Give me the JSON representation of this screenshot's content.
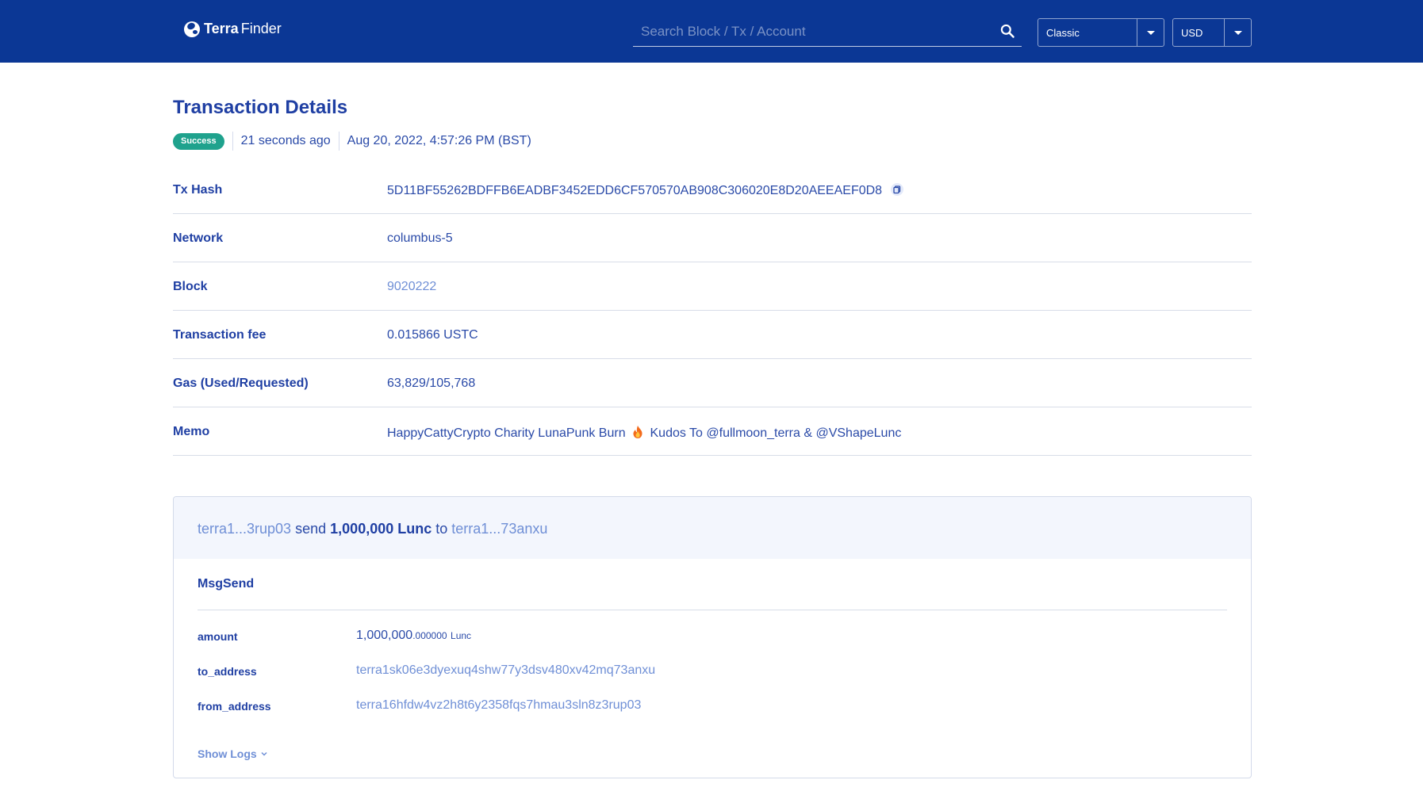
{
  "header": {
    "logo_strong": "Terra",
    "logo_light": "Finder",
    "search_placeholder": "Search Block / Tx / Account",
    "network_select": "Classic",
    "currency_select": "USD"
  },
  "page": {
    "title": "Transaction Details",
    "status": "Success",
    "time_ago": "21 seconds ago",
    "timestamp": "Aug 20, 2022, 4:57:26 PM (BST)"
  },
  "details": {
    "tx_hash": {
      "label": "Tx Hash",
      "value": "5D11BF55262BDFFB6EADBF3452EDD6CF570570AB908C306020E8D20AEEAEF0D8"
    },
    "network": {
      "label": "Network",
      "value": "columbus-5"
    },
    "block": {
      "label": "Block",
      "value": "9020222"
    },
    "fee": {
      "label": "Transaction fee",
      "value": "0.015866 USTC"
    },
    "gas": {
      "label": "Gas (Used/Requested)",
      "value": "63,829/105,768"
    },
    "memo": {
      "label": "Memo",
      "before_icon": "HappyCattyCrypto Charity LunaPunk Burn",
      "icon": "flame-icon",
      "after_icon": "Kudos To",
      "mention1": "@fullmoon_terra",
      "amp": "&",
      "mention2": "@VShapeLunc"
    }
  },
  "message": {
    "summary_from": "terra1...3rup03",
    "summary_action": "send",
    "summary_amount": "1,000,000 Lunc",
    "summary_to_word": "to",
    "summary_to": "terra1...73anxu",
    "type": "MsgSend",
    "fields": {
      "amount": {
        "label": "amount",
        "value_main": "1,000,000",
        "value_decimals": ".000000",
        "value_unit": "Lunc"
      },
      "to_address": {
        "label": "to_address",
        "value": "terra1sk06e3dyexuq4shw77y3dsv480xv42mq73anxu"
      },
      "from_address": {
        "label": "from_address",
        "value": "terra16hfdw4vz2h8t6y2358fqs7hmau3sln8z3rup03"
      }
    },
    "show_logs": "Show Logs"
  },
  "colors": {
    "header_bg": "#0b3795",
    "primary_text": "#1f3fa3",
    "link": "#6f8fd6",
    "success": "#1fa28d"
  }
}
